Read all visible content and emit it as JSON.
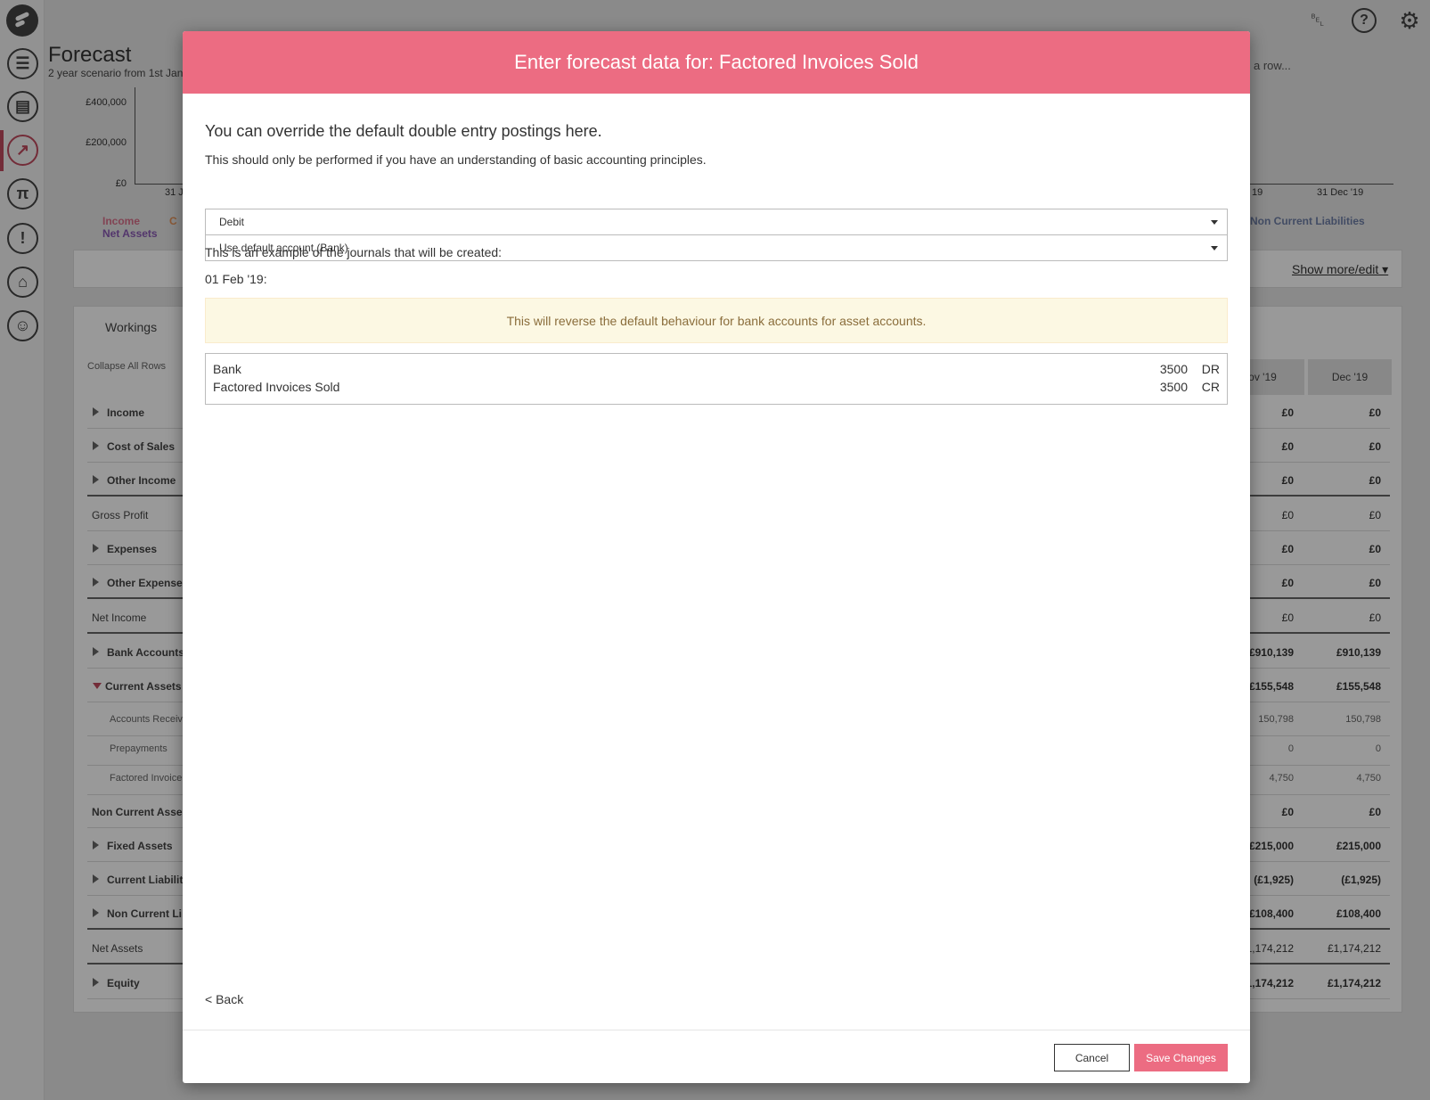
{
  "app": {
    "page_title": "Forecast",
    "page_subtitle": "2 year scenario from 1st Jan",
    "click_hint": "a row...",
    "show_more": "Show more/edit ▾"
  },
  "sidebar": {
    "items": [
      {
        "icon": "sliders-icon",
        "glyph": "☰"
      },
      {
        "icon": "report-icon",
        "glyph": "▤"
      },
      {
        "icon": "forecast-chart-icon",
        "glyph": "↗"
      },
      {
        "icon": "pi-icon",
        "glyph": "π"
      },
      {
        "icon": "alert-icon",
        "glyph": "!"
      },
      {
        "icon": "bank-icon",
        "glyph": "⌂"
      },
      {
        "icon": "user-icon",
        "glyph": "☺"
      }
    ]
  },
  "topbar": {
    "bell_glyph": "␇",
    "help_glyph": "?",
    "gear_glyph": "⚙"
  },
  "chart": {
    "y_ticks": [
      "£400,000",
      "£200,000",
      "£0"
    ],
    "x_ticks": [
      "31 J",
      "19",
      "31 Dec '19"
    ],
    "legend": [
      "Income",
      "C",
      "Net Assets",
      "Non Current Liabilities"
    ]
  },
  "workings": {
    "tab_label": "Workings",
    "collapse_label": "Collapse All Rows",
    "columns": [
      "ov '19",
      "Dec '19"
    ],
    "rows": [
      {
        "label": "Income",
        "v1": "£0",
        "v2": "£0"
      },
      {
        "label": "Cost of Sales",
        "v1": "£0",
        "v2": "£0"
      },
      {
        "label": "Other Income",
        "v1": "£0",
        "v2": "£0"
      },
      {
        "label": "Gross Profit",
        "v1": "£0",
        "v2": "£0"
      },
      {
        "label": "Expenses",
        "v1": "£0",
        "v2": "£0"
      },
      {
        "label": "Other Expense",
        "v1": "£0",
        "v2": "£0"
      },
      {
        "label": "Net Income",
        "v1": "£0",
        "v2": "£0"
      },
      {
        "label": "Bank Accounts",
        "v1": "£910,139",
        "v2": "£910,139"
      },
      {
        "label": "Current Assets",
        "v1": "£155,548",
        "v2": "£155,548"
      },
      {
        "label": "Accounts Receiv",
        "v1": "150,798",
        "v2": "150,798"
      },
      {
        "label": "Prepayments",
        "v1": "0",
        "v2": "0"
      },
      {
        "label": "Factored Invoice",
        "v1": "4,750",
        "v2": "4,750"
      },
      {
        "label": "Non Current Asse",
        "v1": "£0",
        "v2": "£0"
      },
      {
        "label": "Fixed Assets",
        "v1": "£215,000",
        "v2": "£215,000"
      },
      {
        "label": "Current Liabilit",
        "v1": "(£1,925)",
        "v2": "(£1,925)"
      },
      {
        "label": "Non Current Li",
        "v1": "£108,400",
        "v2": "£108,400"
      },
      {
        "label": "Net Assets",
        "v1": "£1,174,212",
        "v2": "£1,174,212"
      },
      {
        "label": "Equity",
        "v1": "£1,174,212",
        "v2": "£1,174,212"
      }
    ]
  },
  "modal": {
    "title": "Enter forecast data for: Factored Invoices Sold",
    "heading": "You can override the default double entry postings here.",
    "note": "This should only be performed if you have an understanding of basic accounting principles.",
    "entry_type_select": "Debit",
    "account_select": "Use default account (Bank)",
    "example_label": "This is an example of the journals that will be created:",
    "journal_date": "01 Feb '19:",
    "warning": "This will reverse the default behaviour for bank accounts for asset accounts.",
    "journal_lines": [
      {
        "account": "Bank",
        "amount": "3500",
        "side": "DR"
      },
      {
        "account": "Factored Invoices Sold",
        "amount": "3500",
        "side": "CR"
      }
    ],
    "back_label": "< Back",
    "cancel_label": "Cancel",
    "save_label": "Save Changes"
  },
  "colors": {
    "accent": "#ec6c82",
    "sidebar_active": "#c04a5e",
    "warning_bg": "#fcf8e3",
    "warning_text": "#8a6d3b"
  }
}
